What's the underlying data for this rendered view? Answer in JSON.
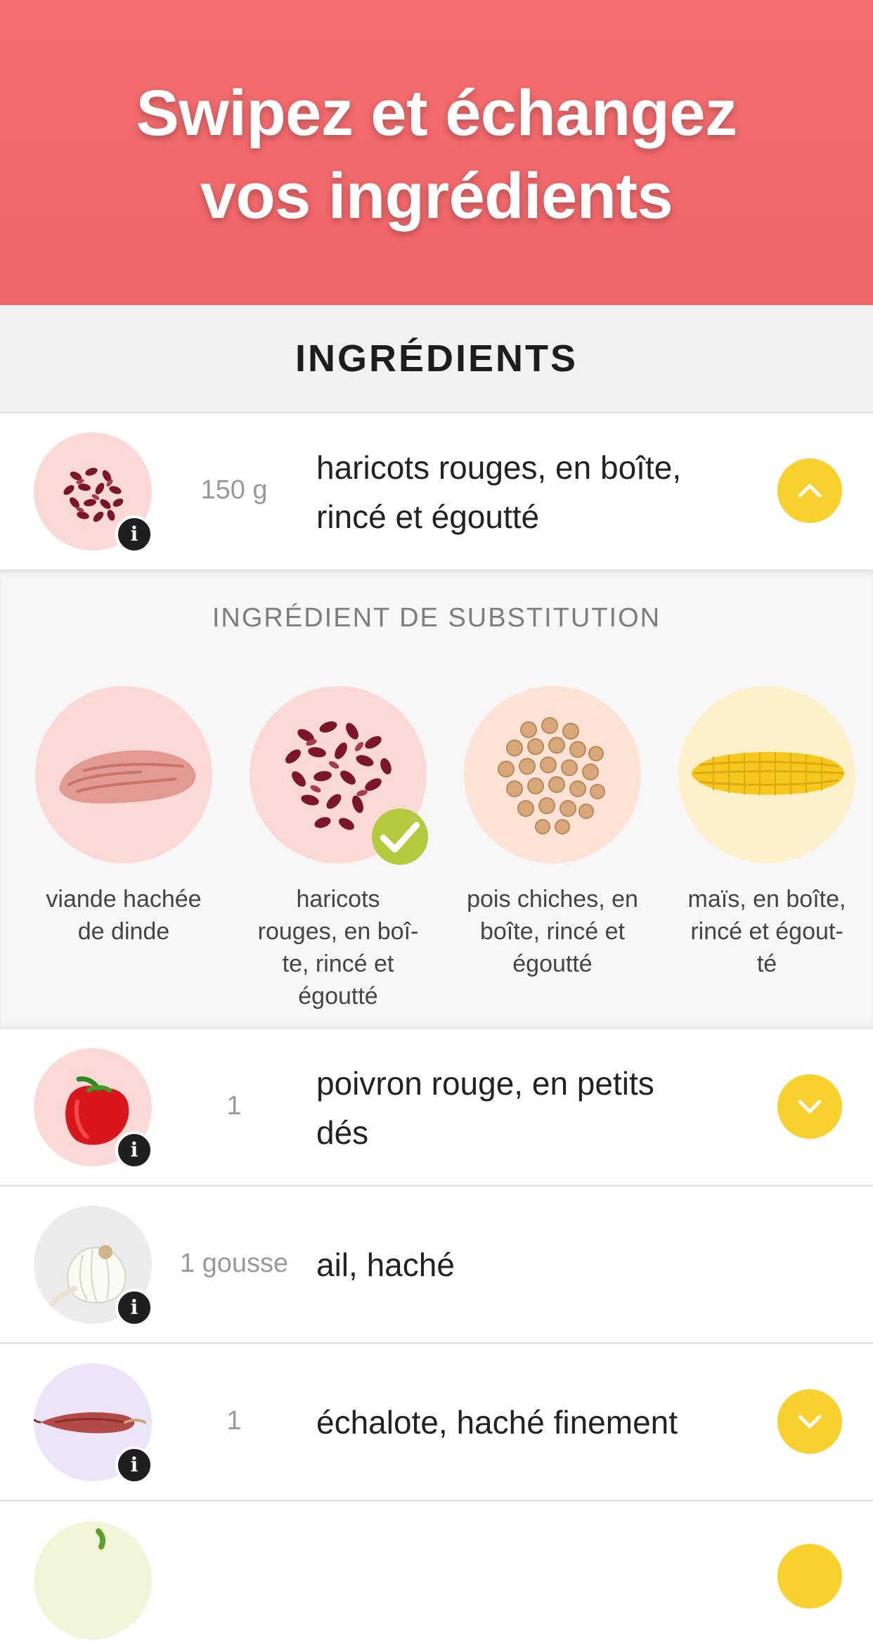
{
  "banner": {
    "line1": "Swipez et échangez",
    "line2": "vos ingrédients"
  },
  "section": {
    "title": "INGRÉDIENTS"
  },
  "substitution": {
    "title": "INGRÉDIENT DE SUBSTITUTION",
    "options": [
      {
        "label_lines": [
          "viande hachée",
          "de dinde"
        ],
        "icon": "ground-turkey-image",
        "selected": false
      },
      {
        "label_lines": [
          "haricots",
          "rouges, en boî-",
          "te, rincé et",
          "égoutté"
        ],
        "icon": "red-kidney-beans-image",
        "selected": true
      },
      {
        "label_lines": [
          "pois chiches, en",
          "boîte, rincé et",
          "égoutté"
        ],
        "icon": "chickpeas-image",
        "selected": false
      },
      {
        "label_lines": [
          "maïs, en boîte,",
          "rincé et égout-",
          "té"
        ],
        "icon": "corn-image",
        "selected": false
      }
    ]
  },
  "ingredients": [
    {
      "qty": "150 g",
      "name_lines": [
        "haricots rouges, en boîte,",
        "rincé et égoutté"
      ],
      "icon": "red-kidney-beans-image",
      "toggle": "chevron-up-icon"
    },
    {
      "qty": "1",
      "name_lines": [
        "poivron rouge, en petits",
        "dés"
      ],
      "icon": "red-pepper-image",
      "toggle": "chevron-down-icon"
    },
    {
      "qty": "1 gousse",
      "name_lines": [
        "ail, haché"
      ],
      "icon": "garlic-image",
      "toggle": ""
    },
    {
      "qty": "1",
      "name_lines": [
        "échalote, haché finement"
      ],
      "icon": "shallot-image",
      "toggle": "chevron-down-icon"
    }
  ],
  "info_glyph": "i",
  "colors": {
    "banner": "#f06567",
    "toggle": "#f8d12f",
    "check": "#b5c93e"
  }
}
